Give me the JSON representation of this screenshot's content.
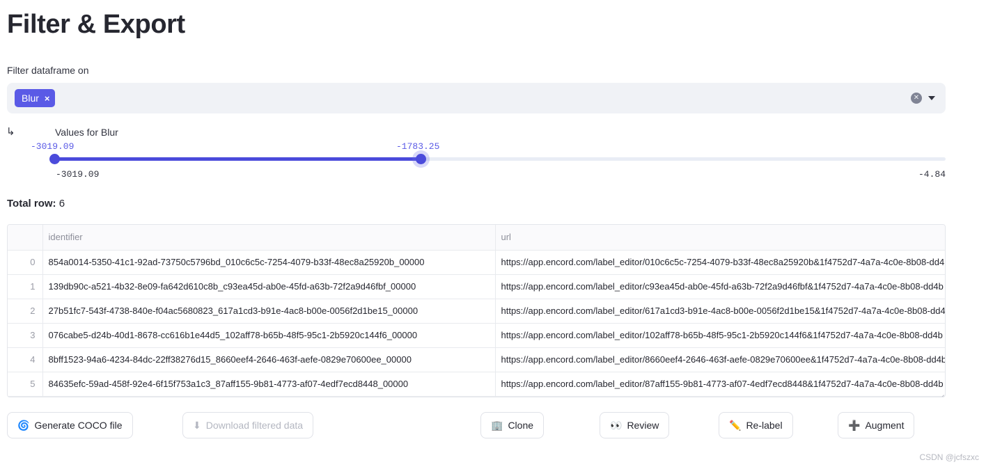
{
  "page": {
    "title": "Filter & Export",
    "watermark": "CSDN @jcfszxc"
  },
  "filter": {
    "label": "Filter dataframe on",
    "chips": [
      {
        "label": "Blur",
        "remove_icon": "×"
      }
    ],
    "clear_icon": "clear-all-icon",
    "dropdown_icon": "chevron-down-icon"
  },
  "slider": {
    "branch_icon": "↳",
    "caption": "Values for Blur",
    "selected_min": "-3019.09",
    "selected_max": "-1783.25",
    "range_min": "-3019.09",
    "range_max": "-4.84",
    "fill_color": "#4b4bdb",
    "track_color": "#e9edf5",
    "value_label_color": "#5a5ae6",
    "fill_percent": 41.1
  },
  "summary": {
    "total_row_label": "Total row:",
    "total_row_value": "6"
  },
  "dataframe": {
    "columns": [
      "identifier",
      "url"
    ],
    "rows": [
      {
        "index": "0",
        "identifier": "854a0014-5350-41c1-92ad-73750c5796bd_010c6c5c-7254-4079-b33f-48ec8a25920b_00000",
        "url": "https://app.encord.com/label_editor/010c6c5c-7254-4079-b33f-48ec8a25920b&1f4752d7-4a7a-4c0e-8b08-dd4"
      },
      {
        "index": "1",
        "identifier": "139db90c-a521-4b32-8e09-fa642d610c8b_c93ea45d-ab0e-45fd-a63b-72f2a9d46fbf_00000",
        "url": "https://app.encord.com/label_editor/c93ea45d-ab0e-45fd-a63b-72f2a9d46fbf&1f4752d7-4a7a-4c0e-8b08-dd4b"
      },
      {
        "index": "2",
        "identifier": "27b51fc7-543f-4738-840e-f04ac5680823_617a1cd3-b91e-4ac8-b00e-0056f2d1be15_00000",
        "url": "https://app.encord.com/label_editor/617a1cd3-b91e-4ac8-b00e-0056f2d1be15&1f4752d7-4a7a-4c0e-8b08-dd4"
      },
      {
        "index": "3",
        "identifier": "076cabe5-d24b-40d1-8678-cc616b1e44d5_102aff78-b65b-48f5-95c1-2b5920c144f6_00000",
        "url": "https://app.encord.com/label_editor/102aff78-b65b-48f5-95c1-2b5920c144f6&1f4752d7-4a7a-4c0e-8b08-dd4b"
      },
      {
        "index": "4",
        "identifier": "8bff1523-94a6-4234-84dc-22ff38276d15_8660eef4-2646-463f-aefe-0829e70600ee_00000",
        "url": "https://app.encord.com/label_editor/8660eef4-2646-463f-aefe-0829e70600ee&1f4752d7-4a7a-4c0e-8b08-dd4b"
      },
      {
        "index": "5",
        "identifier": "84635efc-59ad-458f-92e4-6f15f753a1c3_87aff155-9b81-4773-af07-4edf7ecd8448_00000",
        "url": "https://app.encord.com/label_editor/87aff155-9b81-4773-af07-4edf7ecd8448&1f4752d7-4a7a-4c0e-8b08-dd4b"
      }
    ]
  },
  "actions": {
    "generate_coco": {
      "label": "Generate COCO file",
      "icon": "🌀",
      "enabled": true
    },
    "download_filtered": {
      "label": "Download filtered data",
      "icon": "⬇",
      "enabled": false
    },
    "clone": {
      "label": "Clone",
      "icon": "🏢",
      "enabled": true
    },
    "review": {
      "label": "Review",
      "icon": "👀",
      "enabled": true
    },
    "relabel": {
      "label": "Re-label",
      "icon": "✏️",
      "enabled": true
    },
    "augment": {
      "label": "Augment",
      "icon": "➕",
      "enabled": true
    }
  }
}
